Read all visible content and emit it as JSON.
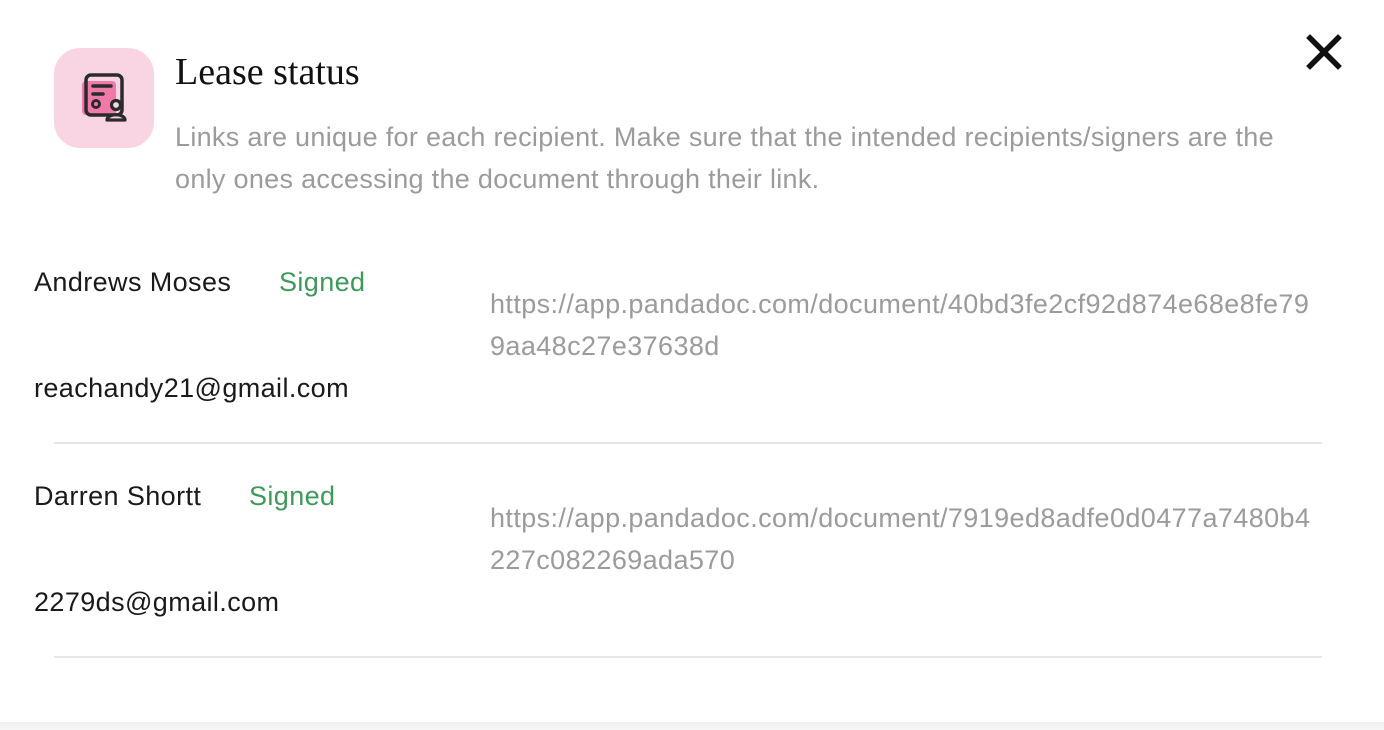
{
  "dialog": {
    "title": "Lease status",
    "subtitle": "Links are unique for each recipient. Make sure that the intended recipients/signers are the only ones accessing the document through their link.",
    "icon": "document-person-icon",
    "icon_background": "#f9d5e3",
    "icon_color": "#2b2b2b",
    "icon_accent": "#f07aaa",
    "close_icon": "close-icon"
  },
  "recipients": [
    {
      "name": "Andrews Moses",
      "status": "Signed",
      "email": "reachandy21@gmail.com",
      "link": "https://app.pandadoc.com/document/40bd3fe2cf92d874e68e8fe799aa48c27e37638d"
    },
    {
      "name": "Darren Shortt",
      "status": "Signed",
      "email": "2279ds@gmail.com",
      "link": "https://app.pandadoc.com/document/7919ed8adfe0d0477a7480b4227c082269ada570"
    }
  ],
  "colors": {
    "status_signed": "#3d9a5a",
    "muted_text": "#9b9b9b",
    "primary_text": "#1a1a1a",
    "divider": "#e6e6e6"
  }
}
